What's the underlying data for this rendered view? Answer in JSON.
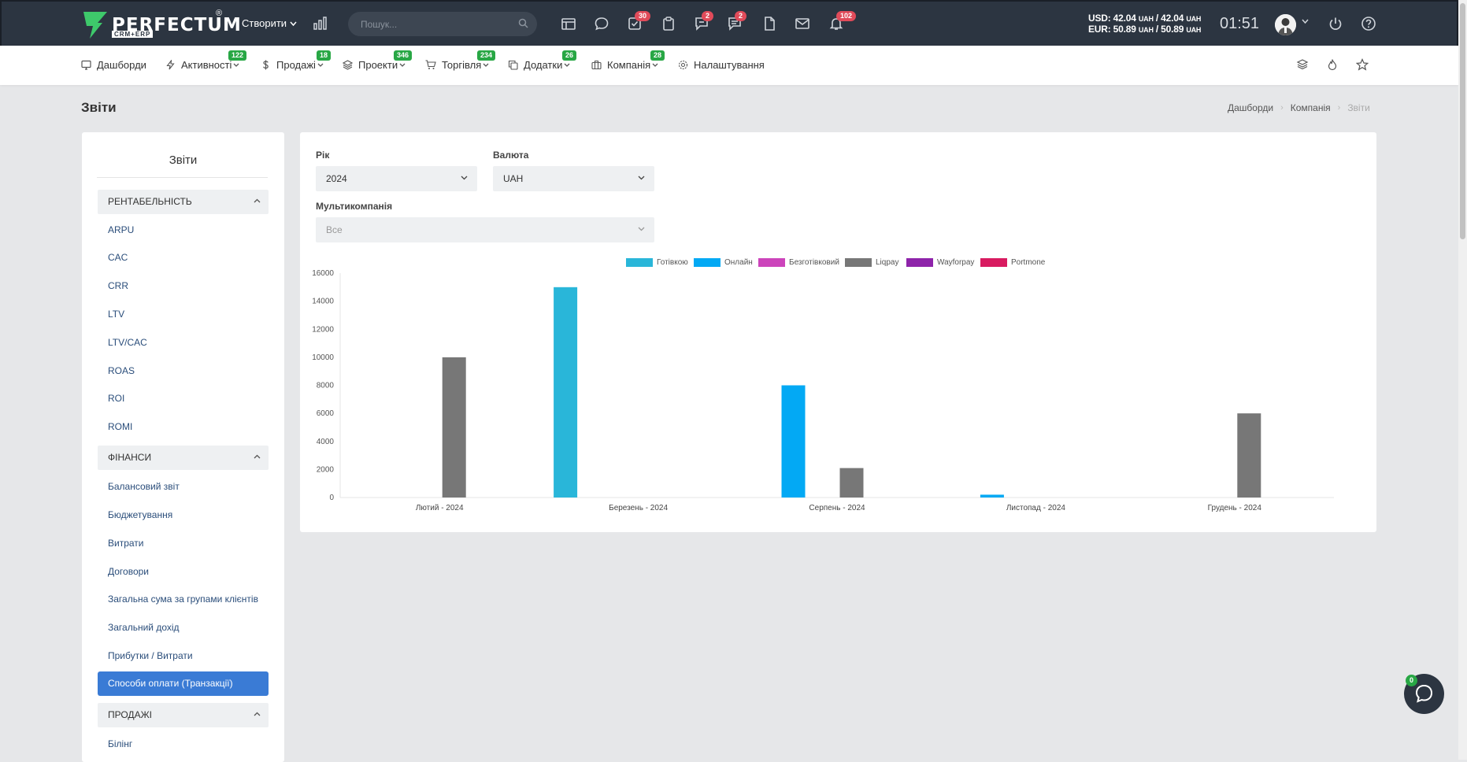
{
  "topbar": {
    "logo_text": "PERFECTUM",
    "logo_reg": "®",
    "logo_sub": "CRM+ERP",
    "create_label": "Створити",
    "search_placeholder": "Пошук...",
    "badges": {
      "tasks": "30",
      "chat": "2",
      "comments": "2",
      "notifications": "102"
    },
    "rates": {
      "usd": "USD: 42.04",
      "usd_unit1": "UAH",
      "usd_sep": " / 42.04",
      "usd_unit2": "UAH",
      "eur": "EUR: 50.89",
      "eur_unit1": "UAH",
      "eur_sep": " / 50.89",
      "eur_unit2": "UAH"
    },
    "time": "01:51"
  },
  "nav": {
    "items": [
      {
        "label": "Дашборди",
        "badge": ""
      },
      {
        "label": "Активності",
        "badge": "122"
      },
      {
        "label": "Продажі",
        "badge": "18"
      },
      {
        "label": "Проекти",
        "badge": "346"
      },
      {
        "label": "Торгівля",
        "badge": "234"
      },
      {
        "label": "Додатки",
        "badge": "26"
      },
      {
        "label": "Компанія",
        "badge": "28"
      },
      {
        "label": "Налаштування",
        "badge": ""
      }
    ]
  },
  "page": {
    "title": "Звіти",
    "breadcrumb": [
      "Дашборди",
      "Компанія",
      "Звіти"
    ]
  },
  "sidebar": {
    "title": "Звіти",
    "groups": [
      {
        "label": "РЕНТАБЕЛЬНІСТЬ",
        "items": [
          "ARPU",
          "CAC",
          "CRR",
          "LTV",
          "LTV/CAC",
          "ROAS",
          "ROI",
          "ROMI"
        ]
      },
      {
        "label": "ФІНАНСИ",
        "items": [
          "Балансовий звіт",
          "Бюджетування",
          "Витрати",
          "Договори",
          "Загальна сума за групами клієнтів",
          "Загальний дохід",
          "Прибутки / Витрати",
          "Способи оплати (Транзакції)"
        ]
      },
      {
        "label": "ПРОДАЖІ",
        "items": [
          "Білінг"
        ]
      }
    ],
    "active_item": "Способи оплати (Транзакції)"
  },
  "filters": {
    "year_label": "Рік",
    "year_value": "2024",
    "currency_label": "Валюта",
    "currency_value": "UAH",
    "multicompany_label": "Мультикомпанія",
    "multicompany_value": "Все"
  },
  "colors": {
    "cash": "#29b6d9",
    "online": "#03a9f4",
    "cashless": "#cc44bb",
    "liqpay": "#777777",
    "wayforpay": "#8e24aa",
    "portmone": "#d81b60",
    "accent": "#3a7bd5",
    "topbar": "#2c3541"
  },
  "chat": {
    "badge": "0"
  },
  "chart_data": {
    "type": "bar",
    "categories": [
      "Лютий - 2024",
      "Березень - 2024",
      "Серпень - 2024",
      "Листопад - 2024",
      "Грудень - 2024"
    ],
    "series": [
      {
        "name": "Готівкою",
        "color": "#29b6d9",
        "values": [
          0,
          15000,
          0,
          0,
          0
        ]
      },
      {
        "name": "Онлайн",
        "color": "#03a9f4",
        "values": [
          0,
          0,
          8000,
          200,
          0
        ]
      },
      {
        "name": "Безготівковий",
        "color": "#cc44bb",
        "values": [
          0,
          0,
          0,
          0,
          0
        ]
      },
      {
        "name": "Liqpay",
        "color": "#777777",
        "values": [
          10000,
          0,
          2100,
          0,
          6000
        ]
      },
      {
        "name": "Wayforpay",
        "color": "#8e24aa",
        "values": [
          0,
          0,
          0,
          0,
          0
        ]
      },
      {
        "name": "Portmone",
        "color": "#d81b60",
        "values": [
          0,
          0,
          0,
          0,
          0
        ]
      }
    ],
    "yticks": [
      "0",
      "2000",
      "4000",
      "6000",
      "8000",
      "10000",
      "12000",
      "14000",
      "16000"
    ],
    "ylim": [
      0,
      16000
    ],
    "legend": "top",
    "grid": false
  }
}
